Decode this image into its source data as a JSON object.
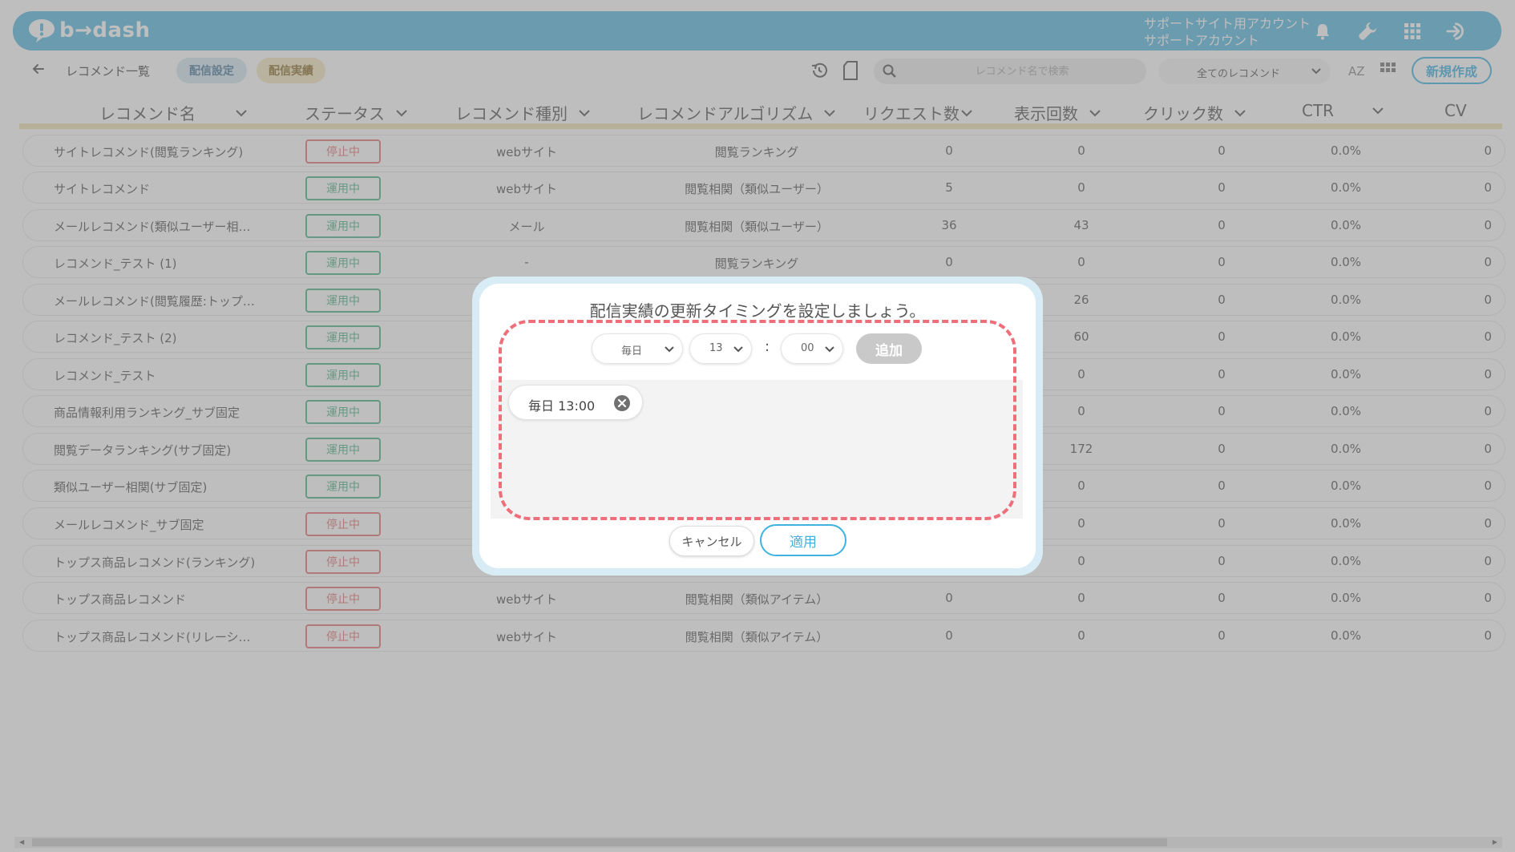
{
  "header": {
    "logo_text": "b→dash",
    "account_line1": "サポートサイト用アカウント",
    "account_line2": "サポートアカウント",
    "brand_color": "#58b8de"
  },
  "toolbar": {
    "breadcrumb": "レコメンド一覧",
    "tab_settings": "配信設定",
    "tab_results": "配信実績",
    "search_placeholder": "レコメンド名で検索",
    "filter_value": "全てのレコメンド",
    "new_button": "新規作成"
  },
  "table": {
    "columns": [
      "レコメンド名",
      "ステータス",
      "レコメンド種別",
      "レコメンドアルゴリズム",
      "リクエスト数",
      "表示回数",
      "クリック数",
      "CTR",
      "CV"
    ],
    "rows": [
      {
        "name": "サイトレコメンド(閲覧ランキング)",
        "status": "停止中",
        "type": "webサイト",
        "algo": "閲覧ランキング",
        "req": "0",
        "views": "0",
        "clicks": "0",
        "ctr": "0.0%",
        "cv": "0"
      },
      {
        "name": "サイトレコメンド",
        "status": "運用中",
        "type": "webサイト",
        "algo": "閲覧相関（類似ユーザー）",
        "req": "5",
        "views": "0",
        "clicks": "0",
        "ctr": "0.0%",
        "cv": "0"
      },
      {
        "name": "メールレコメンド(類似ユーザー相…",
        "status": "運用中",
        "type": "メール",
        "algo": "閲覧相関（類似ユーザー）",
        "req": "36",
        "views": "43",
        "clicks": "0",
        "ctr": "0.0%",
        "cv": "0"
      },
      {
        "name": "レコメンド_テスト (1)",
        "status": "運用中",
        "type": "-",
        "algo": "閲覧ランキング",
        "req": "0",
        "views": "0",
        "clicks": "0",
        "ctr": "0.0%",
        "cv": "0"
      },
      {
        "name": "メールレコメンド(閲覧履歴:トップ…",
        "status": "運用中",
        "type": "",
        "algo": "",
        "req": "",
        "views": "26",
        "clicks": "0",
        "ctr": "0.0%",
        "cv": "0"
      },
      {
        "name": "レコメンド_テスト (2)",
        "status": "運用中",
        "type": "",
        "algo": "",
        "req": "",
        "views": "60",
        "clicks": "0",
        "ctr": "0.0%",
        "cv": "0"
      },
      {
        "name": "レコメンド_テスト",
        "status": "運用中",
        "type": "",
        "algo": "",
        "req": "",
        "views": "0",
        "clicks": "0",
        "ctr": "0.0%",
        "cv": "0"
      },
      {
        "name": "商品情報利用ランキング_サブ固定",
        "status": "運用中",
        "type": "",
        "algo": "",
        "req": "",
        "views": "0",
        "clicks": "0",
        "ctr": "0.0%",
        "cv": "0"
      },
      {
        "name": "閲覧データランキング(サブ固定)",
        "status": "運用中",
        "type": "",
        "algo": "",
        "req": "",
        "views": "172",
        "clicks": "0",
        "ctr": "0.0%",
        "cv": "0"
      },
      {
        "name": "類似ユーザー相関(サブ固定)",
        "status": "運用中",
        "type": "",
        "algo": "",
        "req": "",
        "views": "0",
        "clicks": "0",
        "ctr": "0.0%",
        "cv": "0"
      },
      {
        "name": "メールレコメンド_サブ固定",
        "status": "停止中",
        "type": "",
        "algo": "",
        "req": "",
        "views": "0",
        "clicks": "0",
        "ctr": "0.0%",
        "cv": "0"
      },
      {
        "name": "トップス商品レコメンド(ランキング)",
        "status": "停止中",
        "type": "",
        "algo": "",
        "req": "",
        "views": "0",
        "clicks": "0",
        "ctr": "0.0%",
        "cv": "0"
      },
      {
        "name": "トップス商品レコメンド",
        "status": "停止中",
        "type": "webサイト",
        "algo": "閲覧相関（類似アイテム）",
        "req": "0",
        "views": "0",
        "clicks": "0",
        "ctr": "0.0%",
        "cv": "0"
      },
      {
        "name": "トップス商品レコメンド(リレーシ…",
        "status": "停止中",
        "type": "webサイト",
        "algo": "閲覧相関（類似アイテム）",
        "req": "0",
        "views": "0",
        "clicks": "0",
        "ctr": "0.0%",
        "cv": "0"
      }
    ]
  },
  "modal": {
    "title": "配信実績の更新タイミングを設定しましょう。",
    "frequency": "毎日",
    "hour": "13",
    "colon": ":",
    "minute": "00",
    "add_button": "追加",
    "schedule_chip": "毎日 13:00",
    "cancel_button": "キャンセル",
    "apply_button": "適用",
    "highlight_color": "#ee6e7a"
  }
}
